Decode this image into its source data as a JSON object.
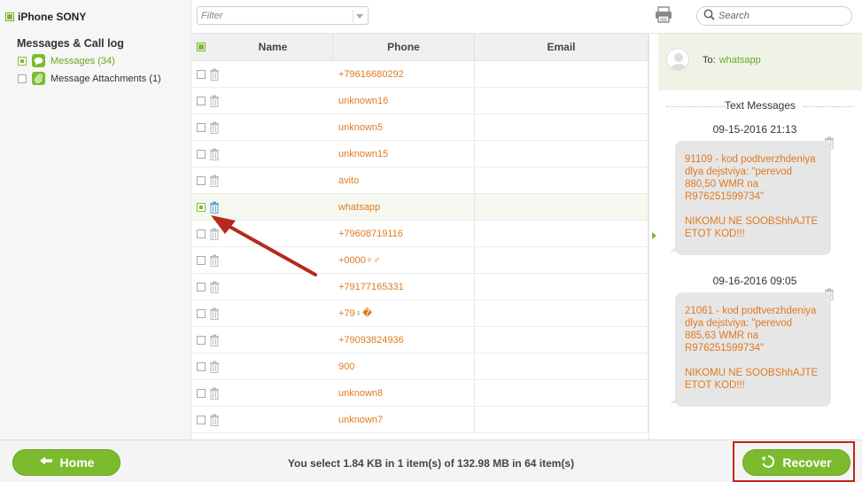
{
  "sidebar": {
    "device_label": "iPhone SONY",
    "section_title": "Messages & Call log",
    "categories": [
      {
        "label": "Messages (34)",
        "checked": true,
        "icon": "chat-bubble-icon"
      },
      {
        "label": "Message Attachments (1)",
        "checked": false,
        "icon": "paperclip-icon"
      }
    ]
  },
  "toolbar": {
    "filter_placeholder": "Filter",
    "search_placeholder": "Search",
    "print_icon": "printer-icon"
  },
  "table": {
    "columns": [
      "Name",
      "Phone",
      "Email"
    ],
    "rows": [
      {
        "name": "",
        "phone": "+79616680292",
        "email": "",
        "checked": false
      },
      {
        "name": "",
        "phone": "unknown16",
        "email": "",
        "checked": false
      },
      {
        "name": "",
        "phone": "unknown5",
        "email": "",
        "checked": false
      },
      {
        "name": "",
        "phone": "unknown15",
        "email": "",
        "checked": false
      },
      {
        "name": "",
        "phone": "avito",
        "email": "",
        "checked": false
      },
      {
        "name": "",
        "phone": "whatsapp",
        "email": "",
        "checked": true
      },
      {
        "name": "",
        "phone": "+79608719116",
        "email": "",
        "checked": false
      },
      {
        "name": "",
        "phone": "+0000♀♂",
        "email": "",
        "checked": false
      },
      {
        "name": "",
        "phone": "+79177165331",
        "email": "",
        "checked": false
      },
      {
        "name": "",
        "phone": "+79♀�",
        "email": "",
        "checked": false
      },
      {
        "name": "",
        "phone": "+79093824936",
        "email": "",
        "checked": false
      },
      {
        "name": "",
        "phone": "900",
        "email": "",
        "checked": false
      },
      {
        "name": "",
        "phone": "unknown8",
        "email": "",
        "checked": false
      },
      {
        "name": "",
        "phone": "unknown7",
        "email": "",
        "checked": false
      }
    ]
  },
  "detail": {
    "to_label": "To:",
    "to_name": "whatsapp",
    "section_title": "Text Messages",
    "messages": [
      {
        "date": "09-15-2016 21:13",
        "text": "91109 - kod podtverzhdeniya dlya dejstviya: \"perevod 880,50 WMR na R976251599734\"\n\nNIKOMU NE SOOBShhAJTE ETOT KOD!!!"
      },
      {
        "date": "09-16-2016 09:05",
        "text": "21061 - kod podtverzhdeniya dlya dejstviya: \"perevod 885,63 WMR na R976251599734\"\n\nNIKOMU NE SOOBShhAJTE ETOT KOD!!!"
      }
    ]
  },
  "footer": {
    "home_label": "Home",
    "recover_label": "Recover",
    "status_text": "You select 1.84 KB in 1 item(s) of 132.98 MB in 64 item(s)"
  },
  "colors": {
    "accent": "#7dbb2e",
    "phone_text": "#e07a20",
    "annotation_red": "#c0251d"
  }
}
